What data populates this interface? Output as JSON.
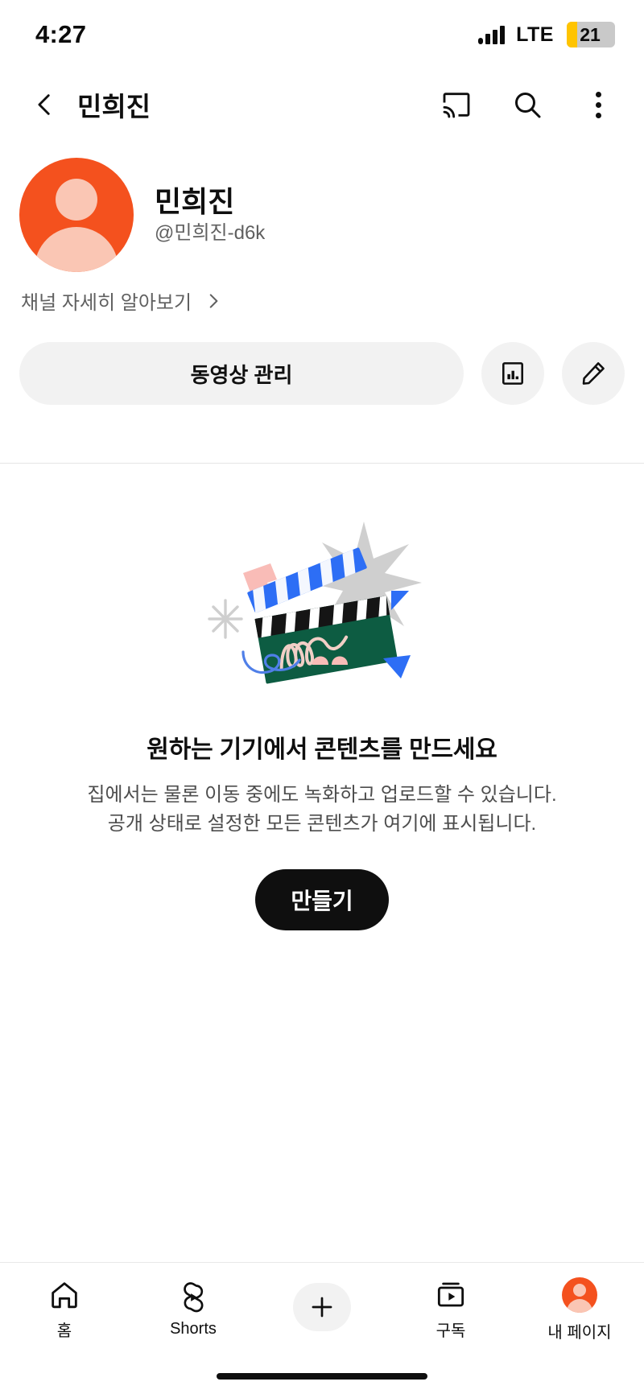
{
  "status_bar": {
    "time": "4:27",
    "network_label": "LTE",
    "battery_percent": "21",
    "battery_fill_color": "#ffc400",
    "signal_icon": "signal-bars-icon"
  },
  "app_bar": {
    "back_icon": "back-chevron-icon",
    "title": "민희진",
    "cast_icon": "cast-icon",
    "search_icon": "search-icon",
    "more_icon": "more-vertical-icon"
  },
  "profile": {
    "avatar_icon": "default-avatar-icon",
    "avatar_color": "#f4511e",
    "channel_name": "민희진",
    "handle": "@민희진-d6k",
    "learn_more_label": "채널 자세히 알아보기",
    "learn_more_chevron": "chevron-right-icon"
  },
  "actions": {
    "manage_videos_label": "동영상 관리",
    "analytics_icon": "bar-chart-icon",
    "edit_icon": "pencil-icon"
  },
  "empty_state": {
    "illustration": "clapperboard-illustration",
    "title": "원하는 기기에서 콘텐츠를 만드세요",
    "description_line1": "집에서는 물론 이동 중에도 녹화하고 업로드할 수 있습니다.",
    "description_line2": "공개 상태로 설정한 모든 콘텐츠가 여기에 표시됩니다.",
    "create_button_label": "만들기"
  },
  "bottom_nav": {
    "items": [
      {
        "label": "홈",
        "icon": "home-icon"
      },
      {
        "label": "Shorts",
        "icon": "shorts-icon"
      },
      {
        "label": "",
        "icon": "plus-icon"
      },
      {
        "label": "구독",
        "icon": "subscriptions-icon"
      },
      {
        "label": "내 페이지",
        "icon": "account-avatar-icon"
      }
    ]
  },
  "colors": {
    "accent": "#f4511e",
    "surface": "#f2f2f2",
    "text_primary": "#0f0f0f",
    "text_secondary": "#606060"
  }
}
